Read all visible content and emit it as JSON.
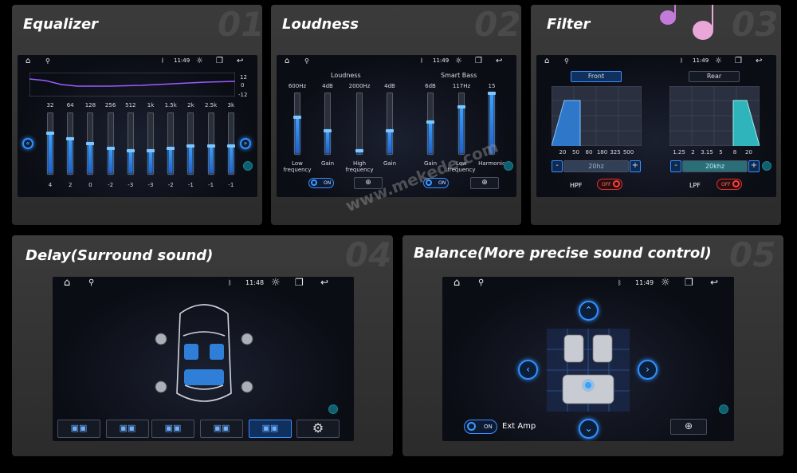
{
  "status_time_a": "11:49",
  "status_time_b": "11:48",
  "watermark": "www.mekede.com",
  "panels": {
    "equalizer": {
      "title": "Equalizer",
      "num": "01",
      "db_labels": [
        "12",
        "0",
        "-12"
      ],
      "bands": [
        "32",
        "64",
        "128",
        "256",
        "512",
        "1k",
        "1.5k",
        "2k",
        "2.5k",
        "3k"
      ],
      "values": [
        "4",
        "2",
        "0",
        "-2",
        "-3",
        "-3",
        "-2",
        "-1",
        "-1",
        "-1"
      ],
      "levels": [
        0.67,
        0.58,
        0.5,
        0.42,
        0.38,
        0.38,
        0.42,
        0.46,
        0.46,
        0.46
      ]
    },
    "loudness": {
      "title": "Loudness",
      "num": "02",
      "section_loudness": "Loudness",
      "section_bass": "Smart Bass",
      "top": [
        "600Hz",
        "4dB",
        "2000Hz",
        "4dB",
        "6dB",
        "117Hz",
        "15"
      ],
      "bottom": [
        "Low\nfrequency",
        "Gain",
        "High\nfrequency",
        "Gain",
        "Gain",
        "Low\nfrequency",
        "Harmonic"
      ],
      "levels": [
        0.6,
        0.38,
        0.05,
        0.38,
        0.52,
        0.78,
        1.0
      ],
      "on_label": "ON"
    },
    "filter": {
      "title": "Filter",
      "num": "03",
      "tab_front": "Front",
      "tab_rear": "Rear",
      "hpf_ticks": [
        "20",
        "50",
        "80",
        "180",
        "325",
        "500"
      ],
      "lpf_ticks": [
        "1.25",
        "2",
        "3.15",
        "5",
        "8",
        "20"
      ],
      "hpf_value": "20hz",
      "lpf_value": "20khz",
      "minus": "-",
      "plus": "+",
      "hpf_label": "HPF",
      "lpf_label": "LPF",
      "off_label": "OFF"
    },
    "delay": {
      "title": "Delay(Surround sound)",
      "num": "04"
    },
    "balance": {
      "title": "Balance(More precise sound control)",
      "num": "05",
      "ext_amp": "Ext Amp",
      "on_label": "ON"
    }
  }
}
